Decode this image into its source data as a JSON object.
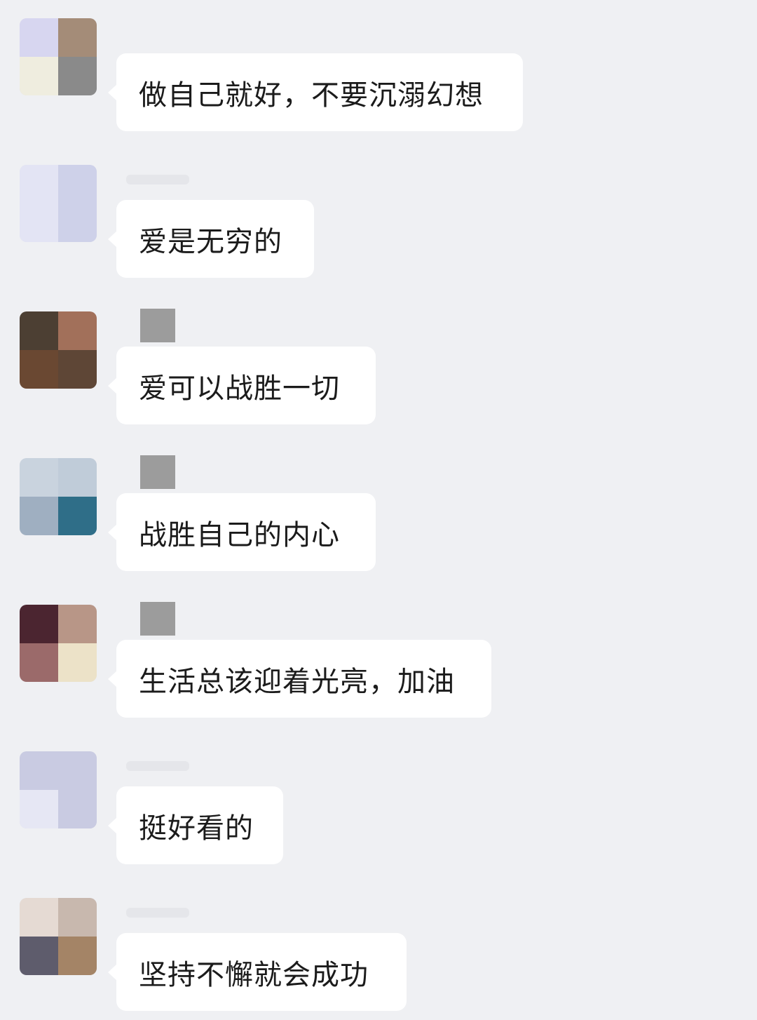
{
  "messages": [
    {
      "text": "做自己就好，不要沉溺幻想",
      "avatar": [
        "#d7d6f0",
        "#a48c78",
        "#efeddf",
        "#8a8a8a"
      ],
      "name_blur": false
    },
    {
      "text": "爱是无穷的",
      "avatar": [
        "#e3e4f4",
        "#ced1e9",
        "#e3e4f4",
        "#ced1e9"
      ],
      "name_blur": false
    },
    {
      "text": "爱可以战胜一切",
      "avatar": [
        "#4c3f33",
        "#a2705a",
        "#6a4832",
        "#5e4636"
      ],
      "name_blur": true
    },
    {
      "text": "战胜自己的内心",
      "avatar": [
        "#c9d3de",
        "#c0ccd9",
        "#9fafc1",
        "#2f6e88"
      ],
      "name_blur": true
    },
    {
      "text": "生活总该迎着光亮，加油",
      "avatar": [
        "#4b2530",
        "#b89687",
        "#9b6a6a",
        "#ece2c8"
      ],
      "name_blur": true
    },
    {
      "text": "挺好看的",
      "avatar": [
        "#c9cbe2",
        "#c9cbe2",
        "#e6e7f4",
        "#c9cbe2"
      ],
      "name_blur": false
    },
    {
      "text": "坚持不懈就会成功",
      "avatar": [
        "#e5dad3",
        "#c8b8ae",
        "#5e5c6c",
        "#a48466"
      ],
      "name_blur": false
    }
  ]
}
